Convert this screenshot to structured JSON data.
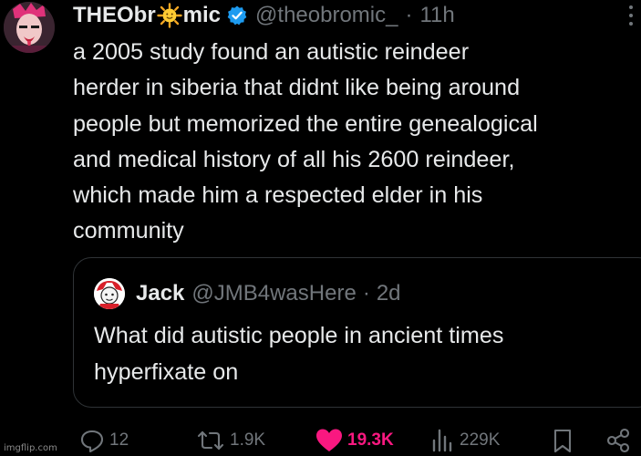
{
  "tweet": {
    "author_name_prefix": "THEObr",
    "author_name_suffix": "mic",
    "name_emoji": "sun-with-face-icon",
    "handle": "@theobromic_",
    "separator": "·",
    "time": "11h",
    "text_lines": [
      "a 2005 study found an autistic reindeer",
      "herder in siberia that didnt like being around",
      "people but memorized the entire genealogical",
      "and medical history of all his 2600 reindeer,",
      "which made him a respected elder in his",
      "community"
    ]
  },
  "quote": {
    "author_name": "Jack",
    "handle": "@JMB4wasHere",
    "separator": "·",
    "time": "2d",
    "text_lines": [
      "What did autistic people in ancient times",
      "hyperfixate on"
    ]
  },
  "actions": {
    "replies": "12",
    "reposts": "1.9K",
    "likes": "19.3K",
    "views": "229K"
  },
  "watermark": "imgflip.com",
  "colors": {
    "background": "#000000",
    "text": "#e7e9ea",
    "muted": "#71767b",
    "verified": "#1d9bf0",
    "like": "#f91880",
    "border": "#2f3336"
  }
}
